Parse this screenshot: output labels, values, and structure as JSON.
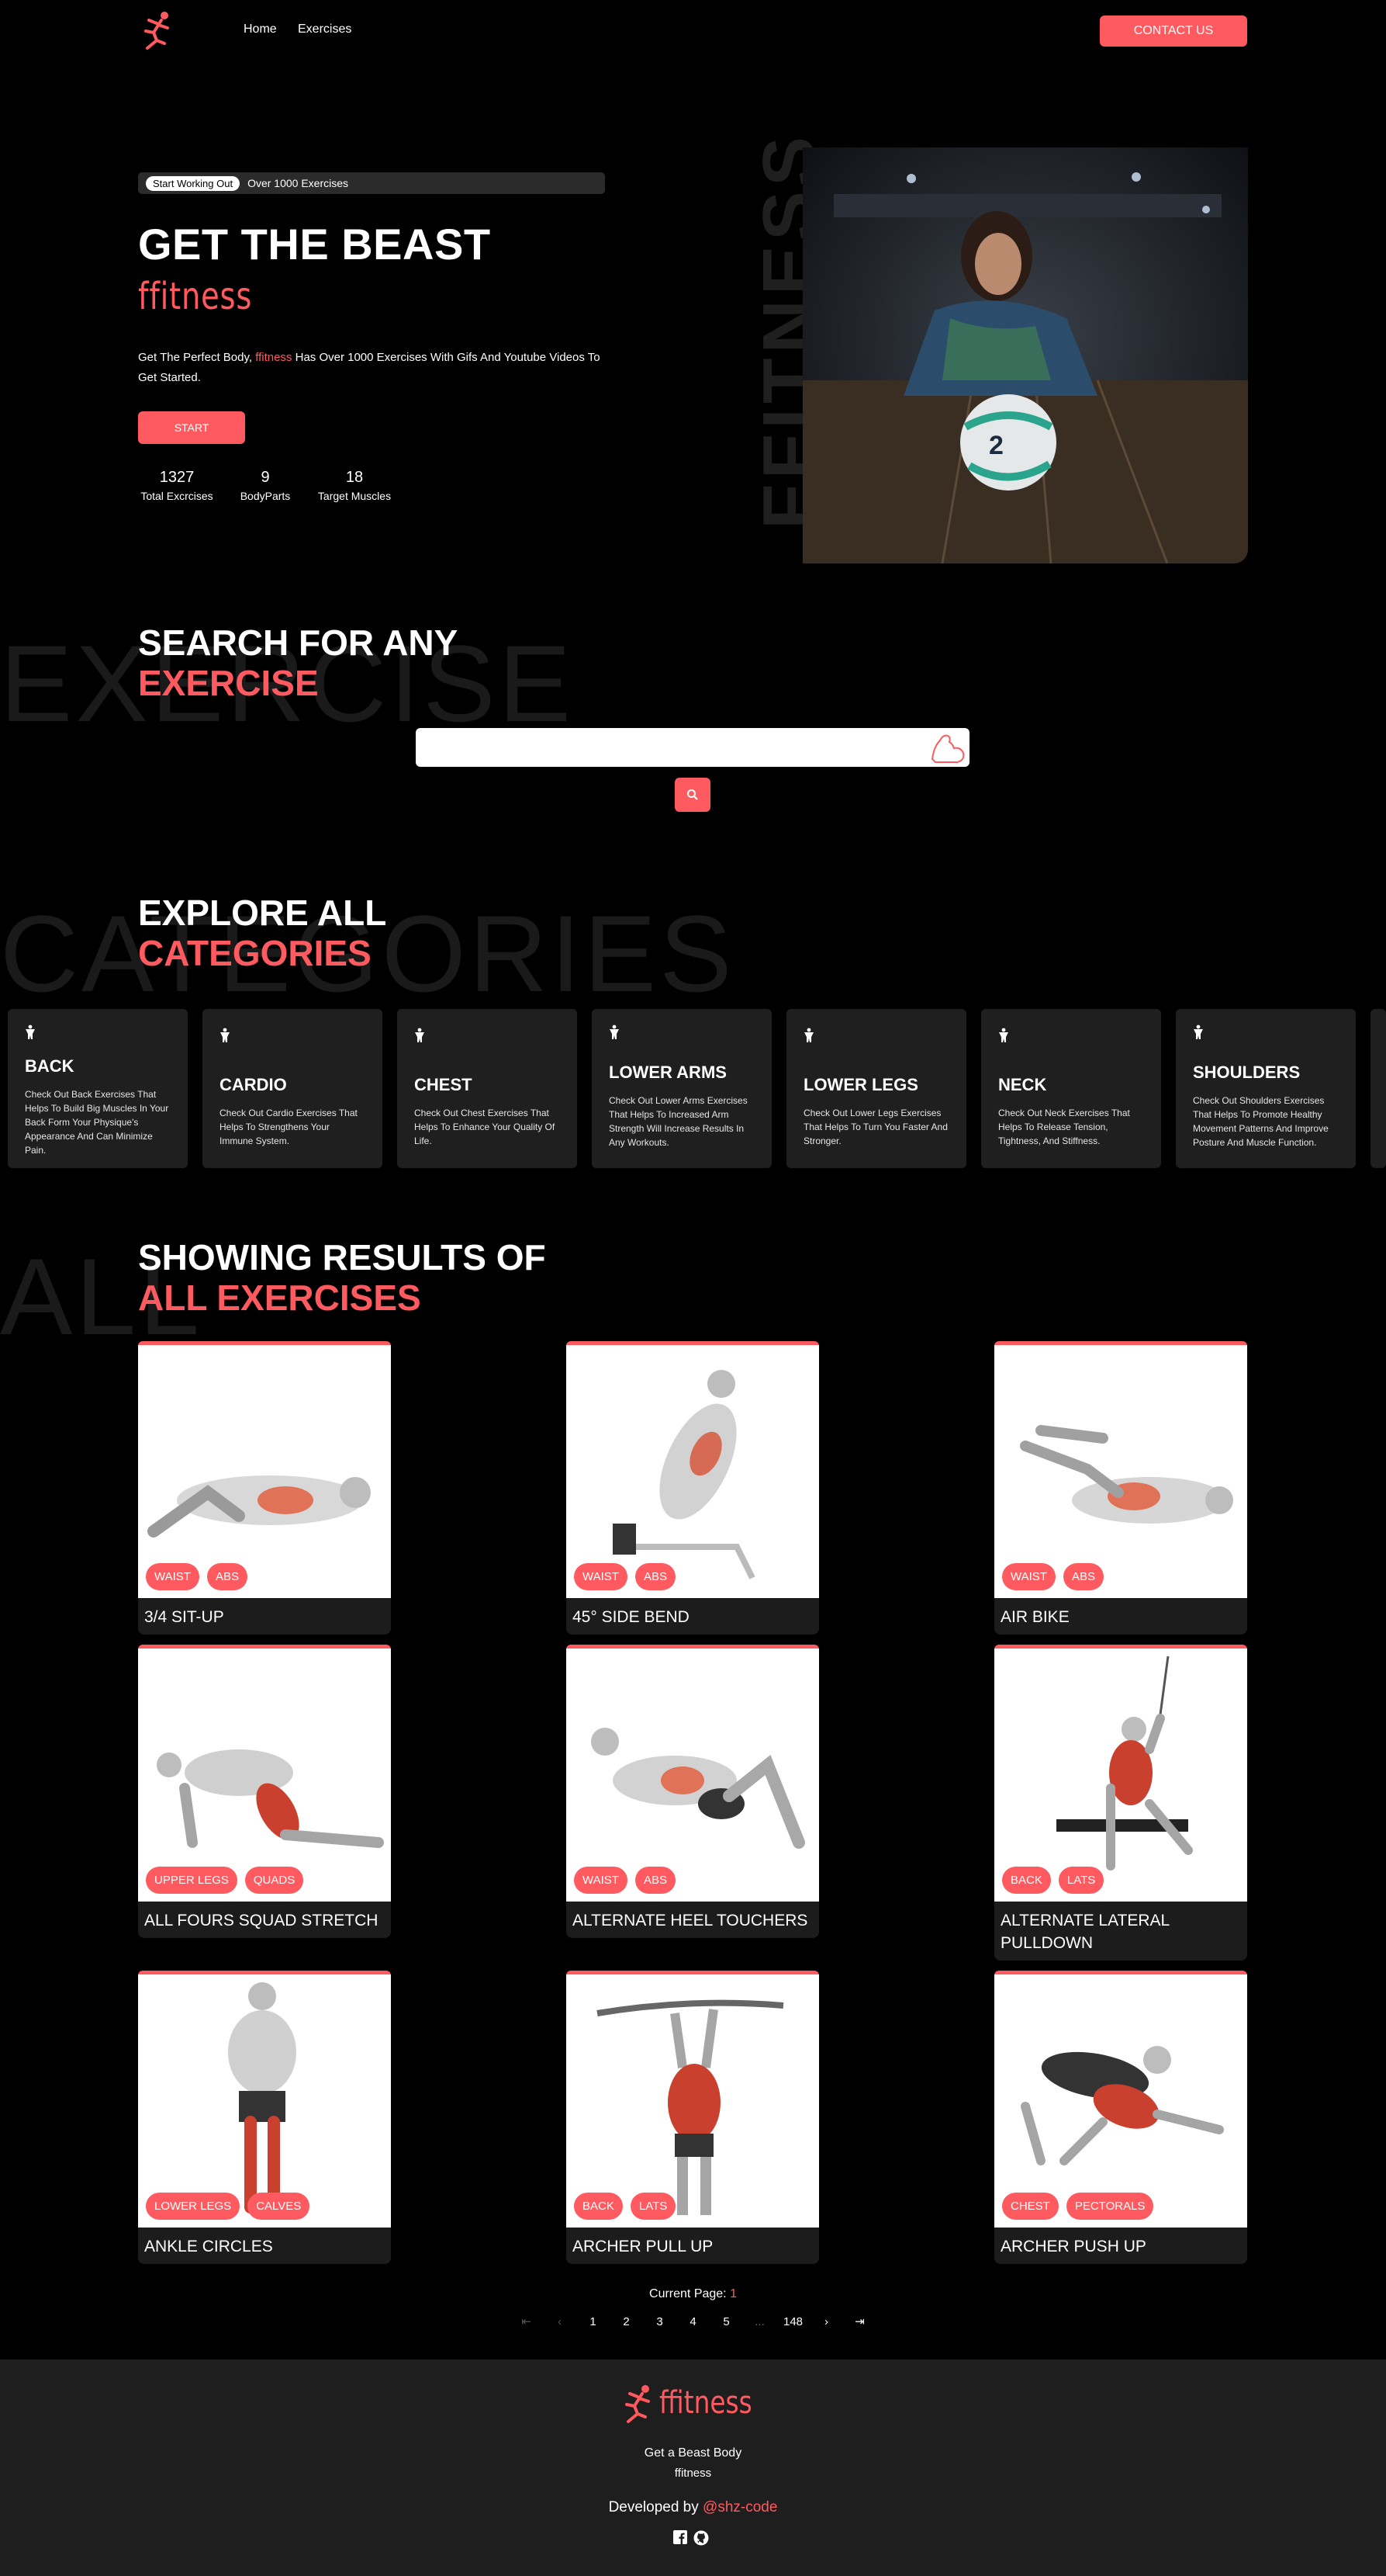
{
  "nav": {
    "links": [
      "Home",
      "Exercises"
    ],
    "contact": "CONTACT US"
  },
  "hero": {
    "pill_tag": "Start Working Out",
    "pill_text": "Over 1000 Exercises",
    "title": "GET THE BEAST",
    "brand": "ffitness",
    "desc_a": "Get The Perfect Body, ",
    "desc_brand": "ffitness",
    "desc_b": " Has Over 1000 Exercises With Gifs And Youtube Videos To Get Started.",
    "start": "START",
    "stats": [
      {
        "value": "1327",
        "label": "Total Excrcises"
      },
      {
        "value": "9",
        "label": "BodyParts"
      },
      {
        "value": "18",
        "label": "Target Muscles"
      }
    ],
    "vertical": "FFITNESS"
  },
  "search": {
    "bg_word": "EXERCISE",
    "line1": "SEARCH FOR ANY",
    "line2": "EXERCISE"
  },
  "categories": {
    "bg_word": "CATEGORIES",
    "line1": "EXPLORE ALL",
    "line2": "CATEGORIES",
    "items": [
      {
        "title": "BACK",
        "desc": "Check Out Back Exercises That Helps To Build Big Muscles In Your Back Form Your Physique's Appearance And Can Minimize Pain."
      },
      {
        "title": "CARDIO",
        "desc": "Check Out Cardio Exercises That Helps To Strengthens Your Immune System."
      },
      {
        "title": "CHEST",
        "desc": "Check Out Chest Exercises That Helps To Enhance Your Quality Of Life."
      },
      {
        "title": "LOWER ARMS",
        "desc": "Check Out Lower Arms Exercises That Helps To Increased Arm Strength Will Increase Results In Any Workouts."
      },
      {
        "title": "LOWER LEGS",
        "desc": "Check Out Lower Legs Exercises That Helps To Turn You Faster And Stronger."
      },
      {
        "title": "NECK",
        "desc": "Check Out Neck Exercises That Helps To Release Tension, Tightness, And Stiffness."
      },
      {
        "title": "SHOULDERS",
        "desc": "Check Out Shoulders Exercises That Helps To Promote Healthy Movement Patterns And Improve Posture And Muscle Function."
      }
    ]
  },
  "results": {
    "bg_word": "ALL",
    "line1": "SHOWING RESULTS OF",
    "line2": "ALL EXERCISES",
    "exercises": [
      {
        "name": "3/4 SIT-UP",
        "tags": [
          "WAIST",
          "ABS"
        ]
      },
      {
        "name": "45° SIDE BEND",
        "tags": [
          "WAIST",
          "ABS"
        ]
      },
      {
        "name": "AIR BIKE",
        "tags": [
          "WAIST",
          "ABS"
        ]
      },
      {
        "name": "ALL FOURS SQUAD STRETCH",
        "tags": [
          "UPPER LEGS",
          "QUADS"
        ]
      },
      {
        "name": "ALTERNATE HEEL TOUCHERS",
        "tags": [
          "WAIST",
          "ABS"
        ]
      },
      {
        "name": "ALTERNATE LATERAL PULLDOWN",
        "tags": [
          "BACK",
          "LATS"
        ]
      },
      {
        "name": "ANKLE CIRCLES",
        "tags": [
          "LOWER LEGS",
          "CALVES"
        ]
      },
      {
        "name": "ARCHER PULL UP",
        "tags": [
          "BACK",
          "LATS"
        ]
      },
      {
        "name": "ARCHER PUSH UP",
        "tags": [
          "CHEST",
          "PECTORALS"
        ]
      }
    ],
    "pager_label": "Current Page: ",
    "current_page": "1",
    "pages": [
      "1",
      "2",
      "3",
      "4",
      "5",
      "...",
      "148"
    ]
  },
  "footer": {
    "brand": "ffitness",
    "tagline": "Get a Beast Body",
    "brand_small": "ffitness",
    "dev_prefix": "Developed by ",
    "dev_handle": "@shz-code"
  },
  "colors": {
    "accent": "#ff5a5f",
    "card": "#1f1f1f",
    "footer": "#1e1e1e"
  },
  "icons": [
    "runner-logo-icon",
    "search-icon",
    "bodybuilder-icon",
    "flexed-arm-icon",
    "facebook-icon",
    "github-icon",
    "first-page-icon",
    "prev-page-icon",
    "next-page-icon",
    "last-page-icon"
  ]
}
